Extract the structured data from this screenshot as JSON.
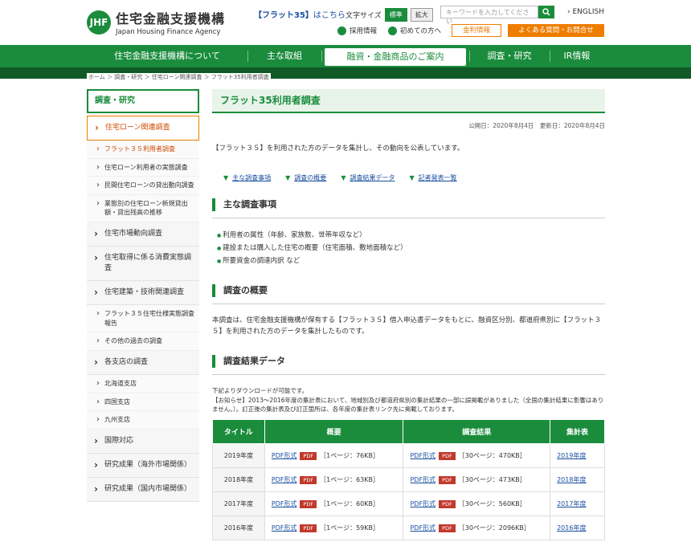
{
  "header": {
    "logo_mark": "JHF",
    "logo_ja": "住宅金融支援機構",
    "logo_en": "Japan Housing Finance Agency",
    "flat35_label": "【フラット35】",
    "flat35_suffix": "はこちら",
    "font_size_label": "文字サイズ",
    "font_standard": "標準",
    "font_large": "拡大",
    "search_placeholder": "キーワードを入力してください",
    "english": "ENGLISH",
    "recruit": "採用情報",
    "first_time": "初めての方へ",
    "fee": "金利情報",
    "faq": "よくある質問・お問合せ"
  },
  "gnav": [
    {
      "label": "住宅金融支援機構について"
    },
    {
      "label": "主な取組"
    },
    {
      "label": "融資・金融商品のご案内"
    },
    {
      "label": "調査・研究"
    },
    {
      "label": "IR情報"
    }
  ],
  "breadcrumb": "ホーム ＞ 調査・研究 ＞ 住宅ローン関連調査 ＞ フラット35利用者調査",
  "sidebar": {
    "heading": "調査・研究",
    "items": [
      {
        "label": "住宅ローン関連調査"
      },
      {
        "label": "フラット３５利用者調査"
      },
      {
        "label": "住宅ローン利用者の実態調査"
      },
      {
        "label": "民間住宅ローンの貸出動向調査"
      },
      {
        "label": "業態別の住宅ローン新規貸出額・貸出残高の推移"
      },
      {
        "label": "住宅市場動向調査"
      },
      {
        "label": "住宅取得に係る消費実態調査"
      },
      {
        "label": "住宅建築・技術関連調査"
      },
      {
        "label": "フラット３５住宅仕様実態調査報告"
      },
      {
        "label": "その他の過去の調査"
      },
      {
        "label": "各支店の調査"
      },
      {
        "label": "北海道支店"
      },
      {
        "label": "四国支店"
      },
      {
        "label": "九州支店"
      },
      {
        "label": "国際対応"
      },
      {
        "label": "研究成果（海外市場関係）"
      },
      {
        "label": "研究成果（国内市場関係）"
      }
    ]
  },
  "main": {
    "title": "フラット35利用者調査",
    "dates": "公開日：2020年8月4日　更新日：2020年8月4日",
    "intro": "【フラット３５】を利用された方のデータを集計し、その動向を公表しています。",
    "anchors": [
      "主な調査事項",
      "調査の概要",
      "調査結果データ",
      "記者発表一覧"
    ],
    "sec1_title": "主な調査事項",
    "bullets": [
      "利用者の属性（年齢、家族数、世帯年収など）",
      "建設または購入した住宅の概要（住宅面積、敷地面積など）",
      "所要資金の調達内訳 など"
    ],
    "sec2_title": "調査の概要",
    "sec2_text": "本調査は、住宅金融支援機構が保有する【フラット３５】借入申込書データをもとに、融資区分別、都道府県別に【フラット３５】を利用された方のデータを集計したものです。",
    "sec3_title": "調査結果データ",
    "note1": "下記よりダウンロードが可能です。",
    "note2": "【お知らせ】2013～2016年度の集計表において、地域別及び都道府県別の集計結果の一部に誤掲載がありました（全国の集計結果に影響はありません。）。訂正後の集計表及び訂正箇所は、各年度の集計表リンク先に掲載しております。",
    "table": {
      "headers": [
        "タイトル",
        "概要",
        "調査結果",
        "集計表"
      ],
      "rows": [
        {
          "year": "2019年度",
          "sum_link": "PDF形式",
          "sum_size": "［1ページ：76KB］",
          "res_link": "PDF形式",
          "res_size": "［30ページ：470KB］",
          "table_link": "2019年度"
        },
        {
          "year": "2018年度",
          "sum_link": "PDF形式",
          "sum_size": "［1ページ：63KB］",
          "res_link": "PDF形式",
          "res_size": "［30ページ：473KB］",
          "table_link": "2018年度"
        },
        {
          "year": "2017年度",
          "sum_link": "PDF形式",
          "sum_size": "［1ページ：60KB］",
          "res_link": "PDF形式",
          "res_size": "［30ページ：560KB］",
          "table_link": "2017年度"
        },
        {
          "year": "2016年度",
          "sum_link": "PDF形式",
          "sum_size": "［1ページ：59KB］",
          "res_link": "PDF形式",
          "res_size": "［30ページ：2096KB］",
          "table_link": "2016年度"
        }
      ],
      "pdf_badge": "PDF"
    }
  }
}
